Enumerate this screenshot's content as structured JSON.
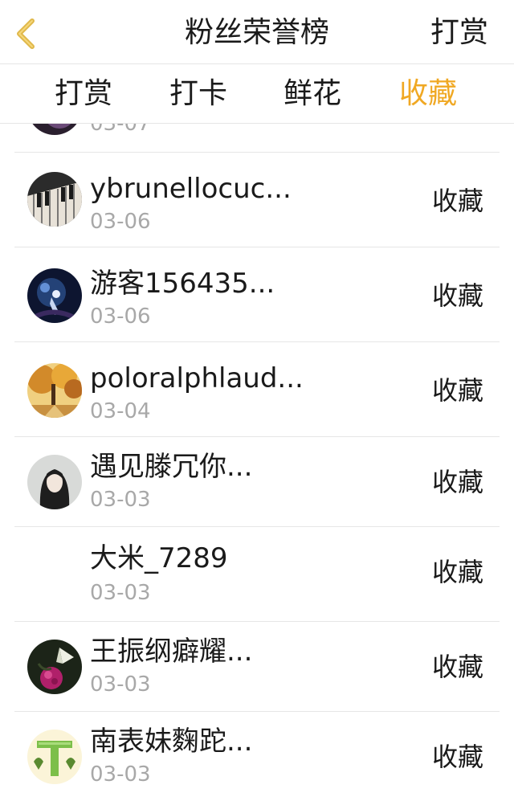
{
  "header": {
    "title": "粉丝荣誉榜",
    "action_label": "打赏",
    "back_icon": "chevron-left-icon",
    "back_color": "#e0b84a"
  },
  "tabs": [
    {
      "label": "打赏",
      "active": false
    },
    {
      "label": "打卡",
      "active": false
    },
    {
      "label": "鲜花",
      "active": false
    },
    {
      "label": "收藏",
      "active": true
    }
  ],
  "colors": {
    "active_tab": "#f0a823",
    "date_text": "#a8a8a8",
    "divider": "#e6e6e6"
  },
  "list": {
    "partial_item": {
      "date": "03-07"
    },
    "items": [
      {
        "name": "ybrunellocuc...",
        "date": "03-06",
        "action": "收藏",
        "avatar": "piano-keys-avatar"
      },
      {
        "name": "游客156435...",
        "date": "03-06",
        "action": "收藏",
        "avatar": "night-scene-avatar"
      },
      {
        "name": "poloralphlaud...",
        "date": "03-04",
        "action": "收藏",
        "avatar": "autumn-tree-avatar"
      },
      {
        "name": "遇见滕冗你...",
        "date": "03-03",
        "action": "收藏",
        "avatar": "girl-portrait-avatar"
      },
      {
        "name": "大米_7289",
        "date": "03-03",
        "action": "收藏",
        "avatar": "empty-avatar"
      },
      {
        "name": "王振纲癖耀...",
        "date": "03-03",
        "action": "收藏",
        "avatar": "flower-butterfly-avatar"
      },
      {
        "name": "南表妹麴跎...",
        "date": "03-03",
        "action": "收藏",
        "avatar": "letter-t-avatar"
      }
    ]
  }
}
